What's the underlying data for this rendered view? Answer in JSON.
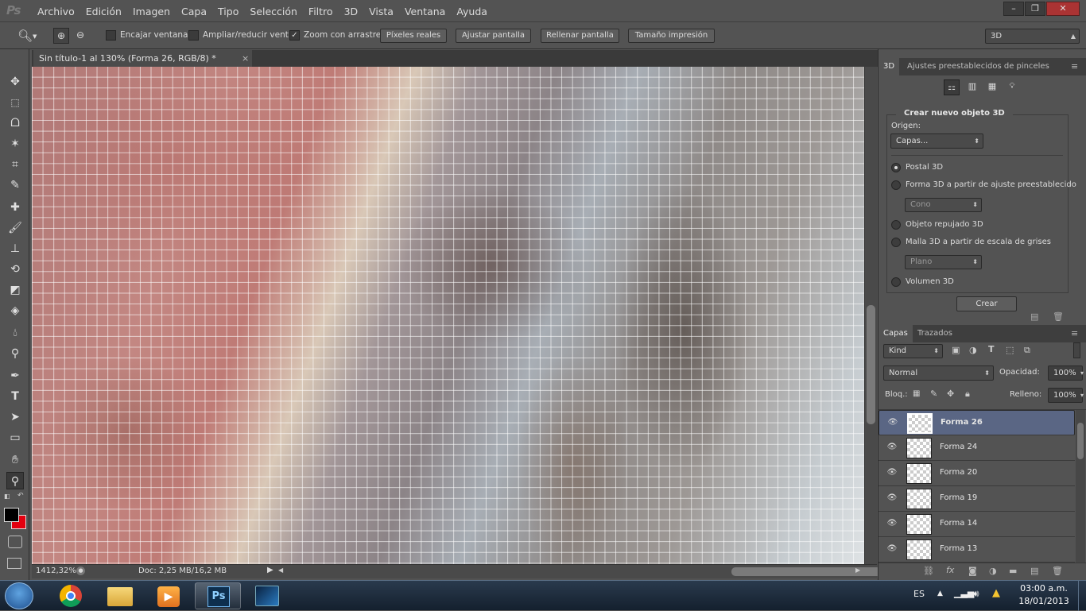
{
  "app": {
    "logo": "Ps"
  },
  "menubar": {
    "items": [
      "Archivo",
      "Edición",
      "Imagen",
      "Capa",
      "Tipo",
      "Selección",
      "Filtro",
      "3D",
      "Vista",
      "Ventana",
      "Ayuda"
    ]
  },
  "window_controls": {
    "minimize": "–",
    "restore": "❐",
    "close": "✕"
  },
  "options": {
    "fit_window": "Encajar ventana",
    "resize_windows": "Ampliar/reducir vent.",
    "scrubby_zoom": "Zoom con arrastre",
    "actual_pixels": "Píxeles reales",
    "fit_screen": "Ajustar pantalla",
    "fill_screen": "Rellenar pantalla",
    "print_size": "Tamaño impresión",
    "workspace": "3D"
  },
  "document": {
    "tab_title": "Sin título-1 al 130% (Forma 26, RGB/8) *",
    "zoom": "1412,32%",
    "doc_info": "Doc: 2,25 MB/16,2 MB"
  },
  "panel3d": {
    "tabs": [
      "3D",
      "Ajustes preestablecidos de pinceles"
    ],
    "section_title": "Crear nuevo objeto 3D",
    "origin_label": "Origen:",
    "origin_value": "Capas...",
    "options": [
      {
        "label": "Postal 3D",
        "selected": true
      },
      {
        "label": "Forma 3D a partir de ajuste preestablecido",
        "selected": false
      },
      {
        "label": "Objeto repujado 3D",
        "selected": false
      },
      {
        "label": "Malla 3D a partir de escala de grises",
        "selected": false
      },
      {
        "label": "Volumen 3D",
        "selected": false
      }
    ],
    "shape_preset": "Cono",
    "mesh_preset": "Plano",
    "create_button": "Crear"
  },
  "layers_panel": {
    "tabs": [
      "Capas",
      "Trazados"
    ],
    "filter": "Kind",
    "blend_mode": "Normal",
    "opacity_label": "Opacidad:",
    "opacity": "100%",
    "lock_label": "Bloq.:",
    "fill_label": "Relleno:",
    "fill": "100%",
    "layers": [
      {
        "name": "Forma 26",
        "selected": true
      },
      {
        "name": "Forma 24",
        "selected": false
      },
      {
        "name": "Forma 20",
        "selected": false
      },
      {
        "name": "Forma 19",
        "selected": false
      },
      {
        "name": "Forma 14",
        "selected": false
      },
      {
        "name": "Forma 13",
        "selected": false
      }
    ]
  },
  "taskbar": {
    "language": "ES",
    "time": "03:00 a.m.",
    "date": "18/01/2013"
  },
  "colors": {
    "foreground": "#000000",
    "background": "#e3000f",
    "selected_layer": "#5a6684"
  }
}
